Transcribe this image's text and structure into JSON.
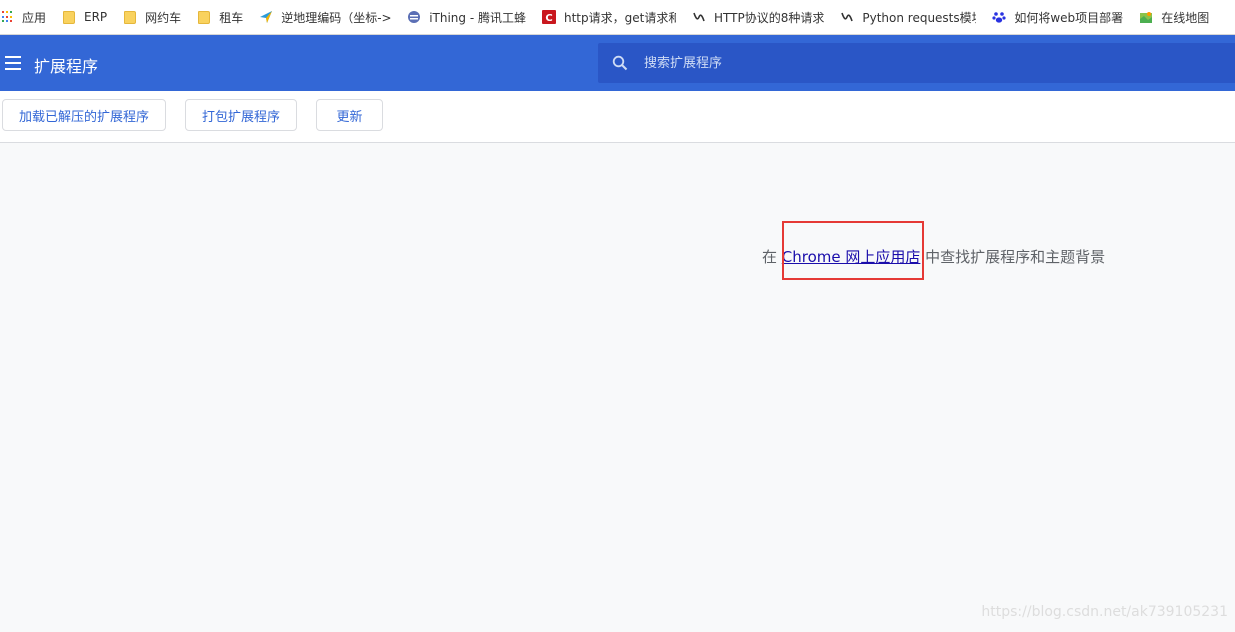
{
  "bookmarks": [
    {
      "label": "应用",
      "icon": "apps-grid-icon"
    },
    {
      "label": "ERP",
      "icon": "folder-icon"
    },
    {
      "label": "网约车",
      "icon": "folder-icon"
    },
    {
      "label": "租车",
      "icon": "folder-icon"
    },
    {
      "label": "逆地理编码（坐标->",
      "icon": "map-pin-icon"
    },
    {
      "label": "iThing - 腾讯工蜂",
      "icon": "gitlab-icon"
    },
    {
      "label": "http请求，get请求和",
      "icon": "csdn-icon"
    },
    {
      "label": "HTTP协议的8种请求",
      "icon": "hook-icon"
    },
    {
      "label": "Python requests模块",
      "icon": "hook-icon"
    },
    {
      "label": "如何将web项目部署",
      "icon": "baidu-paw-icon"
    },
    {
      "label": "在线地图",
      "icon": "map-icon"
    }
  ],
  "header": {
    "title": "扩展程序",
    "search_placeholder": "搜索扩展程序"
  },
  "toolbar": {
    "load_unpacked": "加载已解压的扩展程序",
    "pack": "打包扩展程序",
    "update": "更新"
  },
  "empty_state": {
    "prefix": "在 ",
    "link": "Chrome 网上应用店",
    "suffix": " 中查找扩展程序和主题背景"
  },
  "watermark": "https://blog.csdn.net/ak739105231",
  "colors": {
    "header_bg": "#3367d6",
    "search_bg": "#2a56c6",
    "accent": "#3367d6",
    "highlight_border": "#e53935"
  }
}
